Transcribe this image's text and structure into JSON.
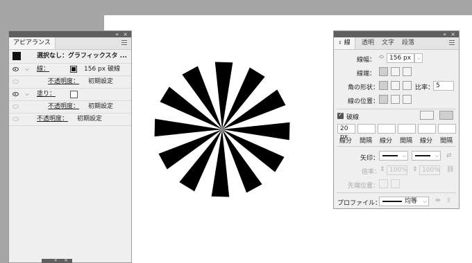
{
  "appearance": {
    "title": "アピアランス",
    "selection_label": "選択なし：グラフィックスタ ...",
    "rows": [
      {
        "kind": "stroke",
        "label": "線：",
        "value": "156 px 破線"
      },
      {
        "kind": "sub",
        "label": "不透明度：",
        "value": "初期設定"
      },
      {
        "kind": "fill",
        "label": "塗り："
      },
      {
        "kind": "sub",
        "label": "不透明度：",
        "value": "初期設定"
      },
      {
        "kind": "opacity",
        "label": "不透明度：",
        "value": "初期設定"
      }
    ]
  },
  "stroke_panel": {
    "tabs": [
      "線",
      "透明",
      "文字",
      "段落"
    ],
    "weight_label": "線幅：",
    "weight_value": "156 px",
    "cap_label": "線端：",
    "corner_label": "角の形状：",
    "limit_label": "比率：",
    "limit_value": "5",
    "align_label": "線の位置：",
    "dashed_label": "破線",
    "dash_first_value": "20 px",
    "dash_labels": [
      "線分",
      "間隔",
      "線分",
      "間隔",
      "線分",
      "間隔"
    ],
    "arrow_label": "矢印：",
    "scale_label": "倍率：",
    "scale_values": [
      "100%",
      "100%"
    ],
    "align_arrow_label": "先端位置：",
    "profile_label": "プロファイル：",
    "profile_value": "均等"
  },
  "colors": {
    "workspace": "#a6a6a6",
    "artboard": "#ffffff",
    "panel": "#efefef",
    "starburst": "#000000"
  }
}
